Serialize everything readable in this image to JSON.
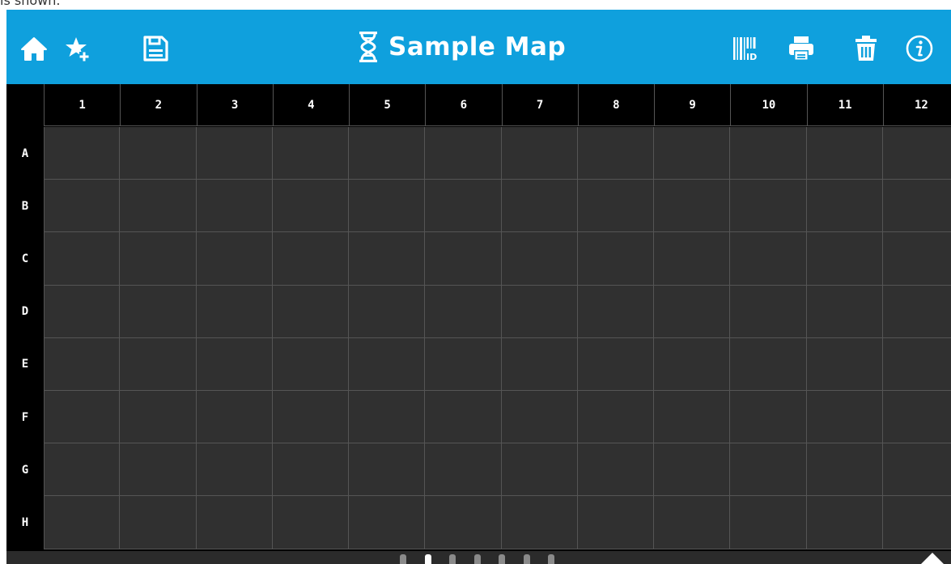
{
  "caption": "is shown.",
  "toolbar": {
    "title": "Sample Map",
    "left_icons": [
      "home-icon",
      "star-plus-icon",
      "save-icon"
    ],
    "title_icon": "dna-icon",
    "right_icons": [
      "barcode-id-icon",
      "print-icon",
      "delete-icon",
      "info-icon"
    ]
  },
  "plate": {
    "columns": [
      "1",
      "2",
      "3",
      "4",
      "5",
      "6",
      "7",
      "8",
      "9",
      "10",
      "11",
      "12"
    ],
    "rows": [
      "A",
      "B",
      "C",
      "D",
      "E",
      "F",
      "G",
      "H"
    ]
  },
  "pager": {
    "page_count": 7,
    "active_page": 2
  },
  "colors": {
    "toolbar": "#0fa0dd",
    "header": "#000000",
    "well": "#303030",
    "grid_line": "#555555"
  }
}
